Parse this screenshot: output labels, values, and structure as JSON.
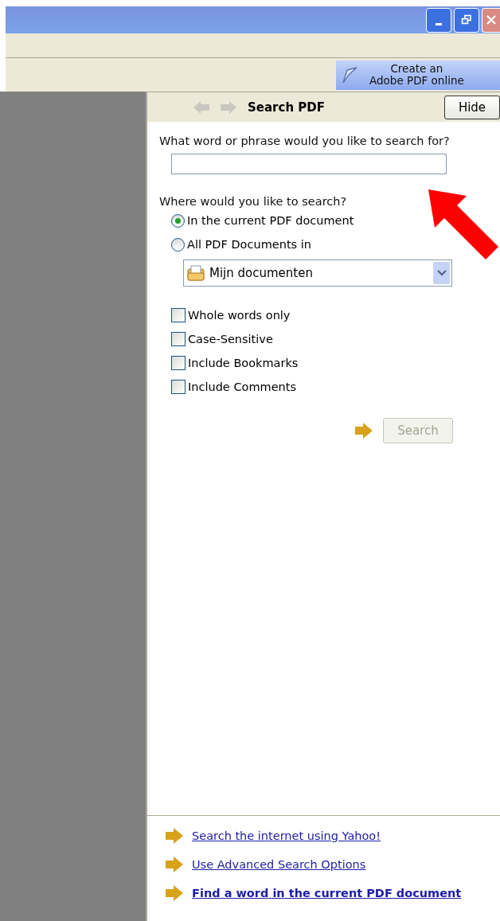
{
  "toolbar": {
    "create_button": {
      "lines": [
        "Create an",
        "Adobe PDF online"
      ]
    }
  },
  "panel": {
    "title": "Search PDF",
    "hide_button": "Hide",
    "query": {
      "label": "What word or phrase would you like to search for?"
    },
    "scope": {
      "label": "Where would you like to search?",
      "options": [
        {
          "label": "In the current PDF document",
          "selected": true
        },
        {
          "label": "All PDF Documents in",
          "selected": false
        }
      ],
      "folder": "Mijn documenten"
    },
    "options": [
      {
        "label": "Whole words only",
        "checked": false
      },
      {
        "label": "Case-Sensitive",
        "checked": false
      },
      {
        "label": "Include Bookmarks",
        "checked": false
      },
      {
        "label": "Include Comments",
        "checked": false
      }
    ],
    "search_button": {
      "label": "Search",
      "disabled": true
    },
    "links": [
      {
        "label": "Search the internet using Yahoo!",
        "bold": false
      },
      {
        "label": "Use Advanced Search Options",
        "bold": false
      },
      {
        "label": "Find a word in the current PDF document",
        "bold": true
      }
    ]
  },
  "annotation": {
    "kind": "arrow"
  }
}
